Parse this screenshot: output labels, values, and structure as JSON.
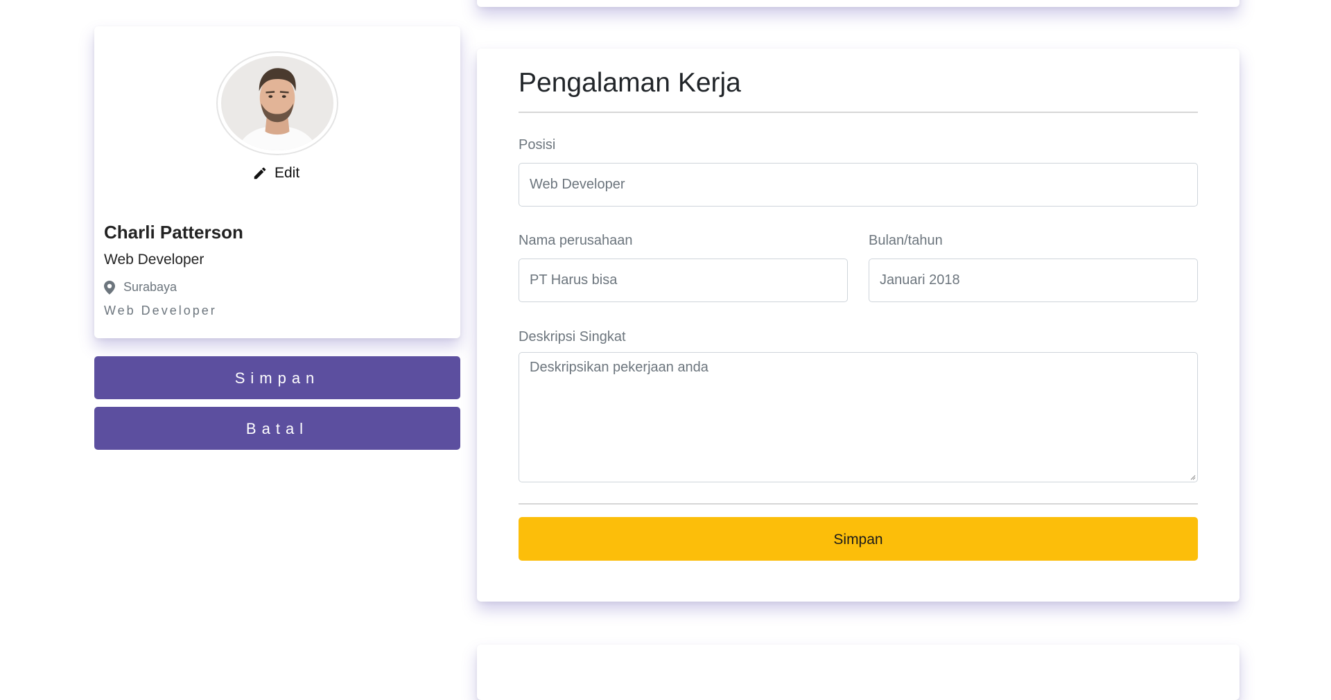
{
  "profile": {
    "edit_label": "Edit",
    "name": "Charli Patterson",
    "role": "Web Developer",
    "location": "Surabaya",
    "tagline": "Web Developer"
  },
  "actions": {
    "save_label": "Simpan",
    "cancel_label": "Batal"
  },
  "experience_form": {
    "title": "Pengalaman Kerja",
    "position": {
      "label": "Posisi",
      "value": "Web Developer"
    },
    "company": {
      "label": "Nama perusahaan",
      "value": "PT Harus bisa"
    },
    "date": {
      "label": "Bulan/tahun",
      "value": "Januari 2018"
    },
    "description": {
      "label": "Deskripsi Singkat",
      "placeholder": "Deskripsikan pekerjaan anda"
    },
    "submit_label": "Simpan"
  },
  "colors": {
    "primary_purple": "#5c4f9f",
    "accent_yellow": "#fcbe0a",
    "muted_text": "#6c757d"
  },
  "icons": {
    "edit": "pencil-icon",
    "location": "map-marker-icon"
  }
}
